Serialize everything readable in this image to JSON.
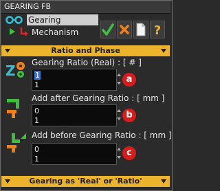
{
  "window": {
    "title": "GEARING FB"
  },
  "tree": {
    "selected_item": "Gearing",
    "child_item": "Mechanism"
  },
  "colors": {
    "accent_yellow": "#ecb42c",
    "badge_red": "#d81c1c",
    "ok_green": "#3fbf3f",
    "cancel_orange": "#f07f1a",
    "icon_cyan": "#33c1d8"
  },
  "toolbar": {
    "buttons": [
      "check-icon",
      "close-icon",
      "new-document-icon",
      "help-icon"
    ]
  },
  "section_ratio": {
    "label": "Ratio and Phase"
  },
  "fields": [
    {
      "label": "Gearing Ratio (Real) : [ # ]",
      "line1": "1",
      "line2": "1",
      "badge": "a",
      "icon": "gears-icon"
    },
    {
      "label": "Add after Gearing Ratio : [ mm ]",
      "line1": "0",
      "line2": "1",
      "badge": "b",
      "icon": "offset-after-icon"
    },
    {
      "label": "Add before Gearing Ratio : [ mm ]",
      "line1": "0",
      "line2": "1",
      "badge": "c",
      "icon": "offset-before-icon"
    }
  ],
  "section_gearing": {
    "label": "Gearing as 'Real' or 'Ratio'"
  }
}
